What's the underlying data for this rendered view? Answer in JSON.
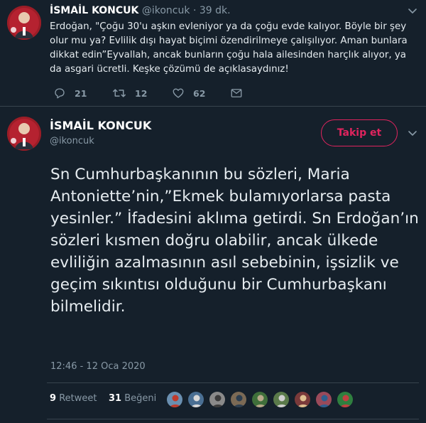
{
  "colors": {
    "background": "#15202b",
    "secondary_text": "#8899a6",
    "accent_pink": "#e0245e",
    "divider": "#38444d"
  },
  "tweet1": {
    "display_name": "İSMAİL KONCUK",
    "handle": "@ikoncuk",
    "separator": "·",
    "time_ago": "39 dk.",
    "text": "Erdoğan, \"Çoğu 30'u aşkın evleniyor ya da çoğu evde kalıyor. Böyle bir şey olur mu ya? Evlilik dışı hayat biçimi özendirilmeye çalışılıyor. Aman bunlara dikkat edin”Eyvallah, ancak bunların çoğu hala ailesinden harçlık alıyor, ya da asgari ücretli. Keşke çözümü de açıklasaydınız!",
    "actions": {
      "reply_count": "21",
      "retweet_count": "12",
      "like_count": "62",
      "reply_icon": "reply-icon",
      "retweet_icon": "retweet-icon",
      "like_icon": "heart-icon",
      "dm_icon": "envelope-icon"
    }
  },
  "tweet2": {
    "display_name": "İSMAİL KONCUK",
    "handle": "@ikoncuk",
    "follow_label": "Takip et",
    "text": "Sn Cumhurbaşkanının bu sözleri, Maria Antoniette’nin,”Ekmek bulamıyorlarsa pasta yesinler.” İfadesini aklıma getirdi. Sn Erdoğan’ın sözleri kısmen doğru olabilir, ancak ülkede evliliğin azalmasının asıl sebebinin, işsizlik ve geçim sıkıntısı olduğunu bir Cumhurbaşkanı bilmelidir.",
    "timestamp": "12:46 - 12 Oca 2020",
    "retweet_count": "9",
    "retweet_label": "Retweet",
    "like_count": "31",
    "like_label": "Beğeni",
    "liker_count": 9
  }
}
